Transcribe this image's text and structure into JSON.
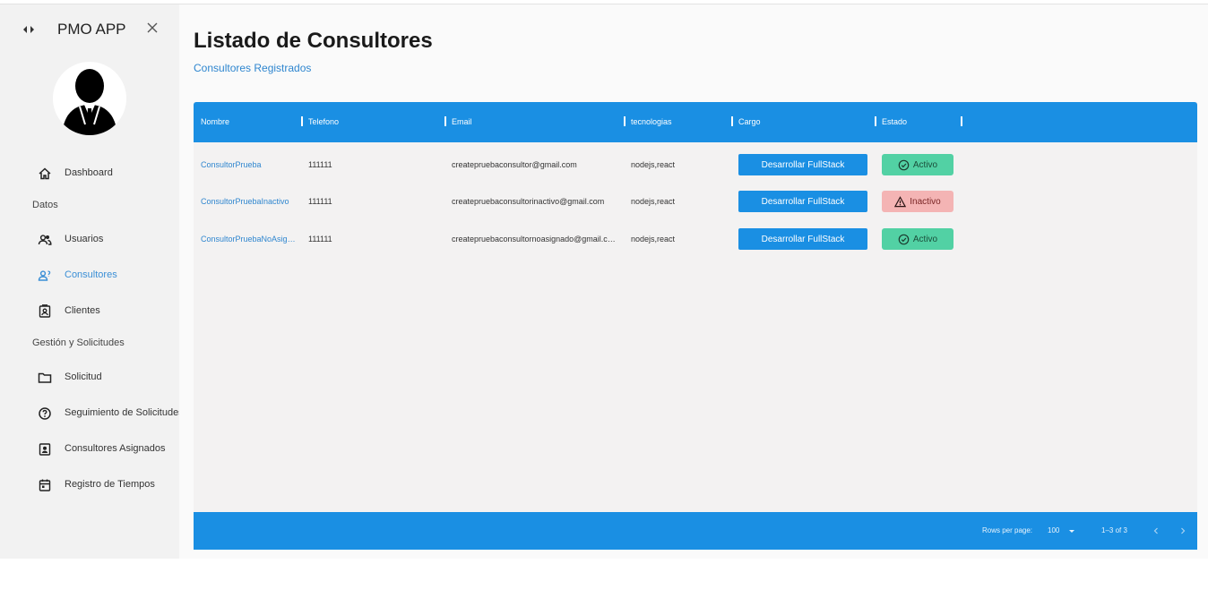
{
  "sidebar": {
    "title": "PMO APP",
    "nav": [
      {
        "label": "Dashboard",
        "icon": "home-icon"
      },
      {
        "label": "Usuarios",
        "icon": "users-icon"
      },
      {
        "label": "Consultores",
        "icon": "consultants-icon"
      },
      {
        "label": "Clientes",
        "icon": "contact-card-icon"
      },
      {
        "label": "Solicitud",
        "icon": "folder-icon"
      },
      {
        "label": "Seguimiento de Solicitudes",
        "icon": "help-circle-icon"
      },
      {
        "label": "Consultores Asignados",
        "icon": "assigned-badge-icon"
      },
      {
        "label": "Registro de Tiempos",
        "icon": "calendar-icon"
      }
    ],
    "sections": {
      "datos": "Datos",
      "gestion": "Gestión y Solicitudes"
    }
  },
  "page": {
    "title": "Listado de Consultores",
    "subtitle": "Consultores Registrados"
  },
  "table": {
    "columns": [
      "Nombre",
      "Telefono",
      "Email",
      "tecnologias",
      "Cargo",
      "Estado"
    ],
    "rows": [
      {
        "nombre": "ConsultorPrueba",
        "telefono": "111111",
        "email": "createpruebaconsultor@gmail.com",
        "tecnologias": "nodejs,react",
        "cargo": "Desarrollar FullStack",
        "estado": "Activo",
        "estado_type": "active"
      },
      {
        "nombre": "ConsultorPruebaInactivo",
        "telefono": "111111",
        "email": "createpruebaconsultorinactivo@gmail.com",
        "tecnologias": "nodejs,react",
        "cargo": "Desarrollar FullStack",
        "estado": "Inactivo",
        "estado_type": "inactive"
      },
      {
        "nombre": "ConsultorPruebaNoAsignado",
        "telefono": "111111",
        "email": "createpruebaconsultornoasignado@gmail.com",
        "tecnologias": "nodejs,react",
        "cargo": "Desarrollar FullStack",
        "estado": "Activo",
        "estado_type": "active"
      }
    ],
    "footer": {
      "rows_per_page_label": "Rows per page:",
      "rows_per_page_value": "100",
      "range": "1–3 of 3"
    }
  },
  "colors": {
    "accent": "#1a8fe3",
    "active": "#52d1a4",
    "inactive": "#f4b4b4",
    "link": "#2f86cf"
  }
}
